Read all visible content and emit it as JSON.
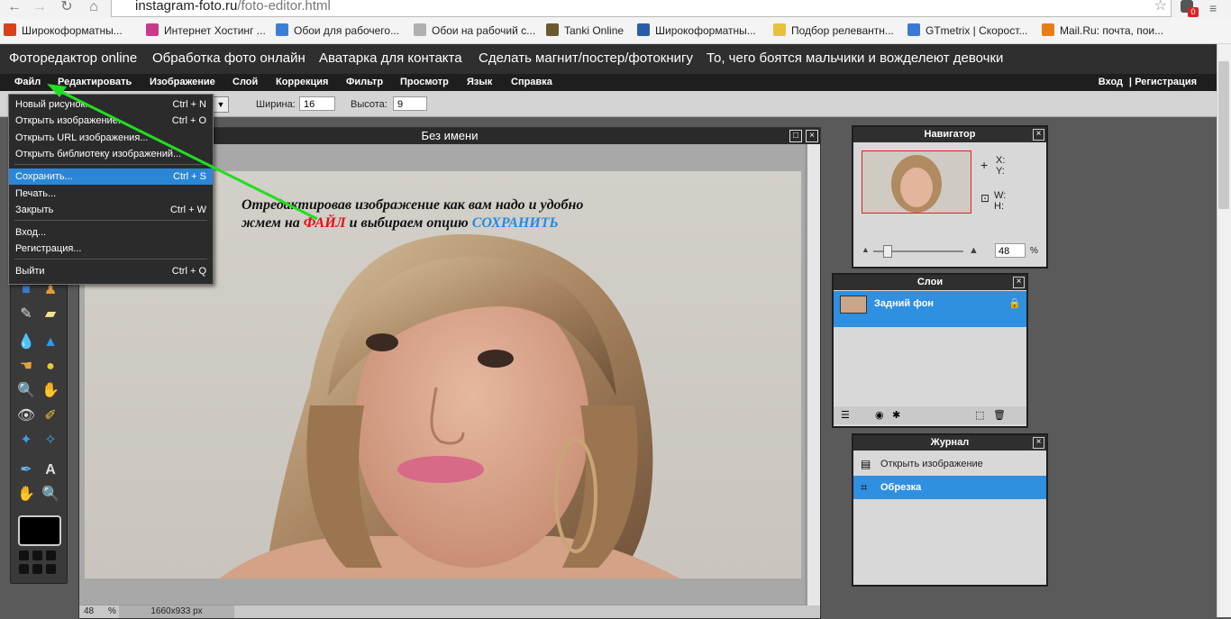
{
  "browser": {
    "url_host": "instagram-foto.ru",
    "url_path": "/foto-editor.html",
    "badge": "0",
    "bookmarks": [
      {
        "label": "Широкоформатны...",
        "icon": "w-logo-icon",
        "color": "#d9401c"
      },
      {
        "label": "Интернет Хостинг ...",
        "icon": "hosting-icon",
        "color": "#c63b8a"
      },
      {
        "label": "Обои для рабочего...",
        "icon": "globe-icon",
        "color": "#3d7fd4"
      },
      {
        "label": "Обои на рабочий с...",
        "icon": "page-icon",
        "color": "#b0b0b0"
      },
      {
        "label": "Tanki Online",
        "icon": "tank-icon",
        "color": "#6b5a2a"
      },
      {
        "label": "Широкоформатны...",
        "icon": "s-logo-icon",
        "color": "#2b5ea8"
      },
      {
        "label": "Подбор релевантн...",
        "icon": "a-logo-icon",
        "color": "#e6c23a"
      },
      {
        "label": "GTmetrix | Скорост...",
        "icon": "gtmetrix-icon",
        "color": "#3a7ad6"
      },
      {
        "label": "Mail.Ru: почта, пои...",
        "icon": "mailru-icon",
        "color": "#e67e1a"
      }
    ]
  },
  "site_nav": [
    "Фоторедактор online",
    "Обработка фото онлайн",
    "Аватарка для контакта",
    "Сделать магнит/постер/фотокнигу",
    "То, чего боятся мальчики и вожделеют девочки"
  ],
  "app_menu": [
    "Файл",
    "Редактировать",
    "Изображение",
    "Слой",
    "Коррекция",
    "Фильтр",
    "Просмотр",
    "Язык",
    "Справка"
  ],
  "auth": {
    "login": "Вход",
    "separator": "|",
    "register": "Регистрация"
  },
  "options": {
    "width_label": "Ширина:",
    "width_value": "16",
    "height_label": "Высота:",
    "height_value": "9"
  },
  "file_menu": {
    "items": [
      {
        "label": "Новый рисунок...",
        "shortcut": "Ctrl + N"
      },
      {
        "label": "Открыть изображение...",
        "shortcut": "Ctrl + O"
      },
      {
        "label": "Открыть URL изображения...",
        "shortcut": ""
      },
      {
        "label": "Открыть библиотеку изображений...",
        "shortcut": ""
      },
      {
        "label": "Сохранить...",
        "shortcut": "Ctrl + S"
      },
      {
        "label": "Печать...",
        "shortcut": ""
      },
      {
        "label": "Закрыть",
        "shortcut": "Ctrl + W"
      },
      {
        "label": "Вход...",
        "shortcut": ""
      },
      {
        "label": "Регистрация...",
        "shortcut": ""
      },
      {
        "label": "Выйти",
        "shortcut": "Ctrl + Q"
      }
    ]
  },
  "document": {
    "title": "Без имени",
    "zoom": "48",
    "zoom_unit": "%",
    "size": "1660x933 px"
  },
  "annotation": {
    "line1": "Отредактировав изображение как вам надо и удобно",
    "line2_start": "жмем на",
    "highlight1": "ФАЙЛ",
    "line2_mid": "и выбираем опцию",
    "highlight2": "СОХРАНИТЬ",
    "highlight1_color": "#e0101a",
    "highlight2_color": "#1f8de6",
    "arrow_color": "#22dd22"
  },
  "navigator": {
    "title": "Навигатор",
    "x_label": "X:",
    "y_label": "Y:",
    "w_label": "W:",
    "h_label": "H:",
    "zoom": "48",
    "zoom_unit": "%"
  },
  "layers": {
    "title": "Слои",
    "items": [
      {
        "name": "Задний фон"
      }
    ]
  },
  "history": {
    "title": "Журнал",
    "items": [
      "Открыть изображение",
      "Обрезка"
    ]
  }
}
